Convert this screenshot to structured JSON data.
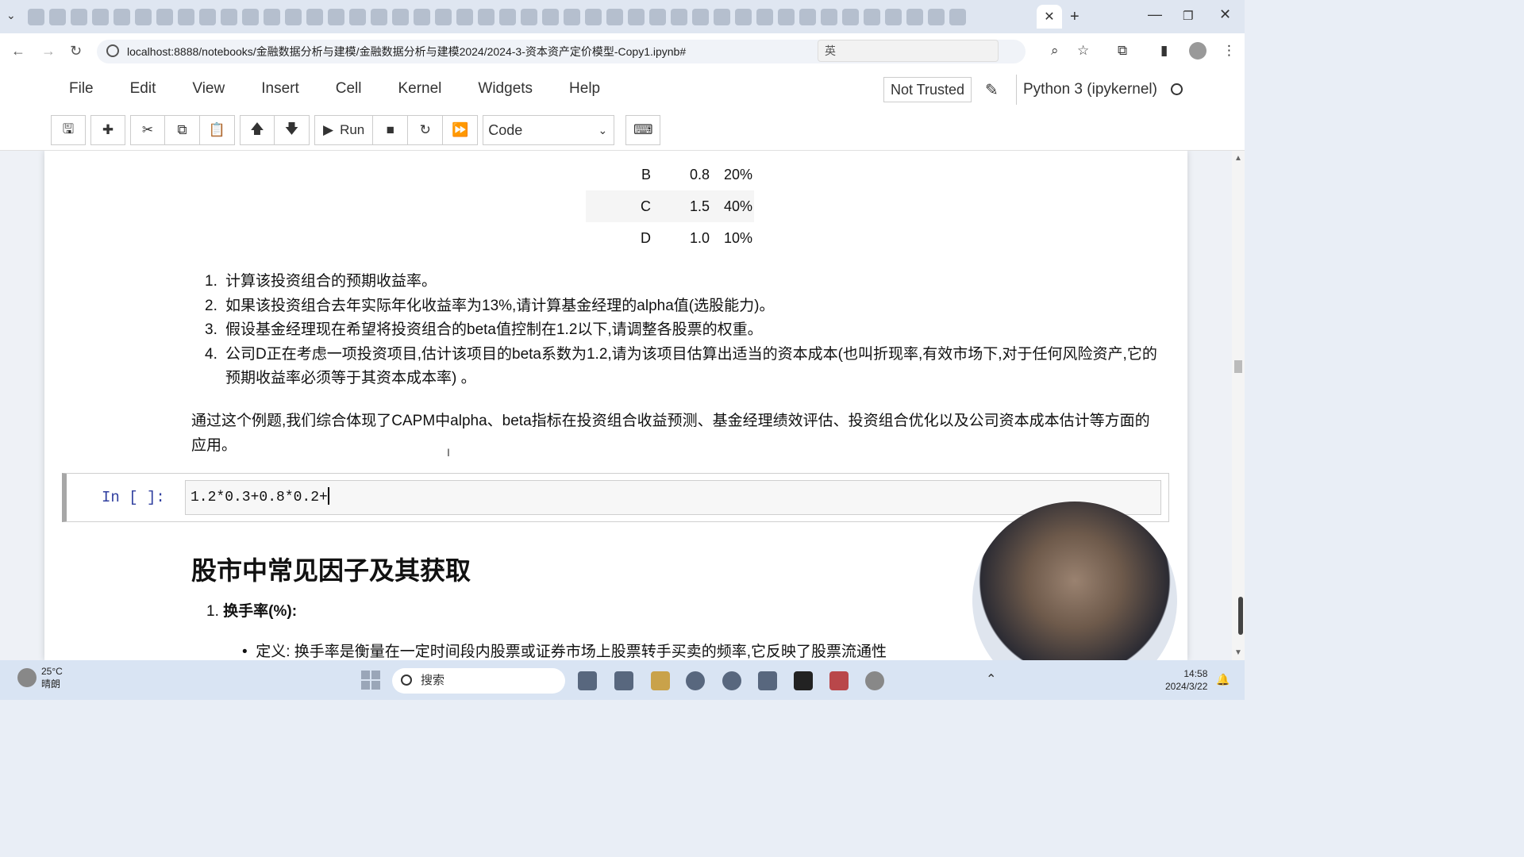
{
  "browser": {
    "url": "localhost:8888/notebooks/金融数据分析与建模/金融数据分析与建模2024/2024-3-资本资产定价模型-Copy1.ipynb#",
    "ime_label": "英",
    "tab_close": "✕",
    "new_tab": "+"
  },
  "notebook": {
    "menu": [
      "File",
      "Edit",
      "View",
      "Insert",
      "Cell",
      "Kernel",
      "Widgets",
      "Help"
    ],
    "trust": "Not Trusted",
    "kernel": "Python 3 (ipykernel)",
    "run_label": "Run",
    "cell_type": "Code"
  },
  "table": {
    "rows": [
      [
        "B",
        "0.8",
        "20%"
      ],
      [
        "C",
        "1.5",
        "40%"
      ],
      [
        "D",
        "1.0",
        "10%"
      ]
    ]
  },
  "questions": [
    {
      "num": "1.",
      "text": "计算该投资组合的预期收益率。"
    },
    {
      "num": "2.",
      "text": "如果该投资组合去年实际年化收益率为13%,请计算基金经理的alpha值(选股能力)。"
    },
    {
      "num": "3.",
      "text": "假设基金经理现在希望将投资组合的beta值控制在1.2以下,请调整各股票的权重。"
    },
    {
      "num": "4.",
      "text": "公司D正在考虑一项投资项目,估计该项目的beta系数为1.2,请为该项目估算出适当的资本成本(也叫折现率,有效市场下,对于任何风险资产,它的预期收益率必须等于其资本成本率) 。"
    }
  ],
  "summary": "通过这个例题,我们综合体现了CAPM中alpha、beta指标在投资组合收益预测、基金经理绩效评估、投资组合优化以及公司资本成本估计等方面的应用。",
  "code_cell": {
    "prompt": "In [ ]:",
    "code": "1.2*0.3+0.8*0.2+"
  },
  "section": {
    "heading": "股市中常见因子及其获取",
    "item1_num": "1.",
    "item1_title": "换手率(%):",
    "bullet_label": "定义:",
    "bullet_text": "换手率是衡量在一定时间段内股票或证券市场上股票转手买卖的频率,它反映了股票流通性"
  },
  "taskbar": {
    "weather_temp": "25°C",
    "weather_desc": "晴朗",
    "search_placeholder": "搜索",
    "time": "14:58",
    "date": "2024/3/22"
  }
}
